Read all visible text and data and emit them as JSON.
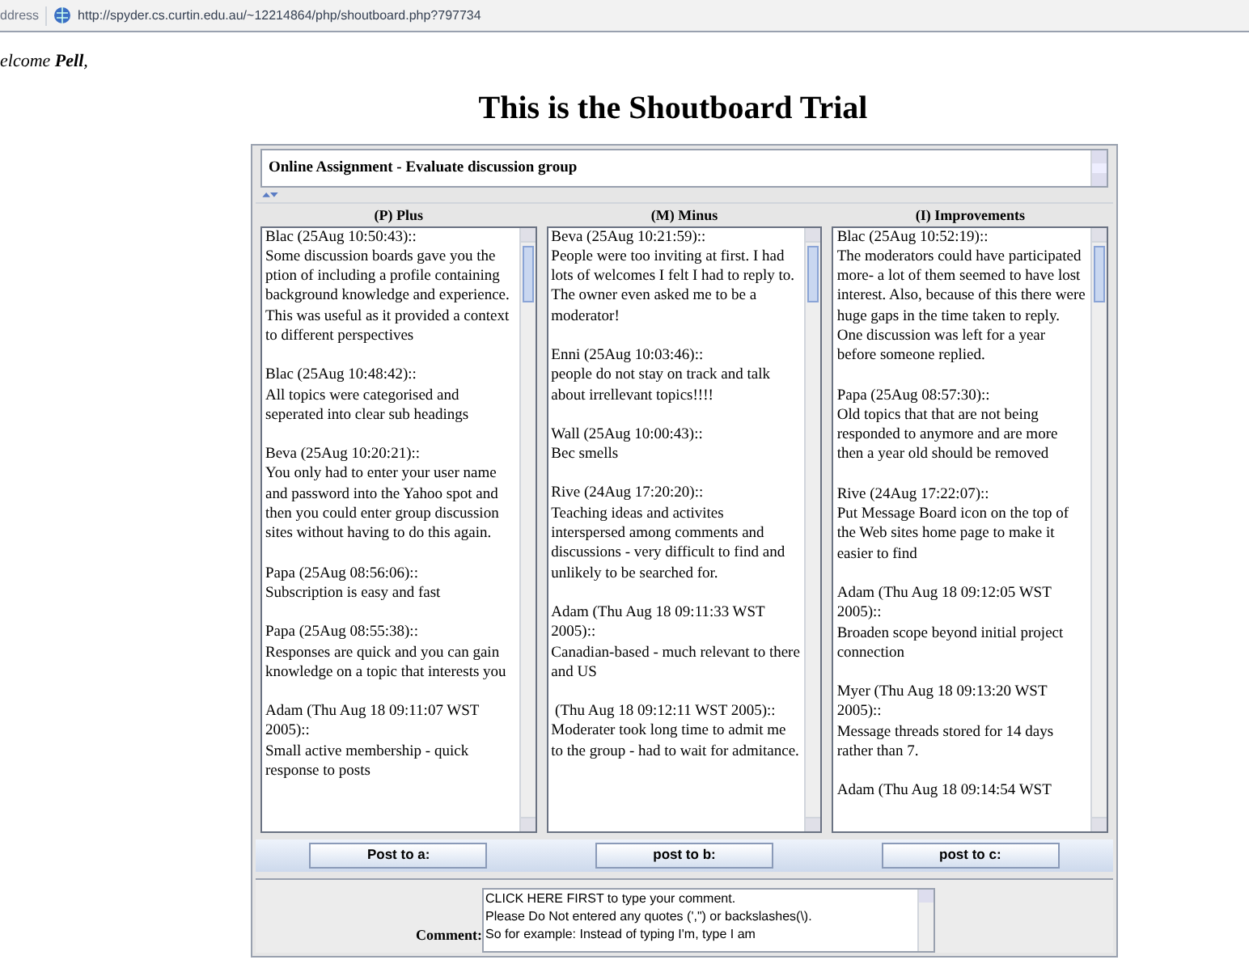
{
  "address_bar": {
    "label": "ddress",
    "url": "http://spyder.cs.curtin.edu.au/~12214864/php/shoutboard.php?797734"
  },
  "welcome": "elcome **Pell**,",
  "title": "This is the Shoutboard Trial",
  "topic": "Online Assignment - Evaluate discussion group",
  "columns": [
    {
      "heading": "(P) Plus",
      "button": "Post to a:",
      "entries": [
        {
          "header": "Blac (25Aug 10:50:43)::",
          "body": "Some discussion boards gave you the ption of including a profile containing background knowledge and experience. This was useful as it provided a context to different perspectives"
        },
        {
          "header": "Blac (25Aug 10:48:42)::",
          "body": "All topics were categorised and seperated into clear sub headings"
        },
        {
          "header": "Beva (25Aug 10:20:21)::",
          "body": "You only had to enter your user name and password into the Yahoo spot and then you could enter group discussion sites without having to do this again."
        },
        {
          "header": "Papa (25Aug 08:56:06)::",
          "body": "Subscription is easy and fast"
        },
        {
          "header": "Papa (25Aug 08:55:38)::",
          "body": "Responses are quick and you can gain knowledge on a topic that interests you"
        },
        {
          "header": "Adam (Thu Aug 18 09:11:07 WST 2005)::",
          "body": "Small active membership - quick response to posts"
        }
      ]
    },
    {
      "heading": "(M) Minus",
      "button": "post to b:",
      "entries": [
        {
          "header": "Beva (25Aug 10:21:59)::",
          "body": "People were too inviting at first. I had lots of welcomes I felt I had to reply to. The owner even asked me to be a moderator!"
        },
        {
          "header": "Enni (25Aug 10:03:46)::",
          "body": "people do not stay on track and talk about irrellevant topics!!!!"
        },
        {
          "header": "Wall (25Aug 10:00:43)::",
          "body": "Bec smells"
        },
        {
          "header": "Rive (24Aug 17:20:20)::",
          "body": "Teaching ideas and activites interspersed among comments and discussions - very difficult to find and unlikely to be searched for."
        },
        {
          "header": "Adam (Thu Aug 18 09:11:33 WST 2005)::",
          "body": "Canadian-based - much relevant to there and US"
        },
        {
          "header": " (Thu Aug 18 09:12:11 WST 2005)::",
          "body": "Moderater took long time to admit me to the group - had to wait for admitance."
        }
      ]
    },
    {
      "heading": "(I) Improvements",
      "button": "post to c:",
      "entries": [
        {
          "header": "Blac (25Aug 10:52:19)::",
          "body": "The moderators could have participated more- a lot of them seemed to have lost interest. Also, because of this there were huge gaps in the time taken to reply. One discussion was left for a year before someone replied."
        },
        {
          "header": "Papa (25Aug 08:57:30)::",
          "body": "Old topics that that are not being responded to anymore and are more then a year old should be removed"
        },
        {
          "header": "Rive (24Aug 17:22:07)::",
          "body": "Put Message Board icon on the top of the Web sites home page to make it easier to find"
        },
        {
          "header": "Adam (Thu Aug 18 09:12:05 WST 2005)::",
          "body": "Broaden scope beyond initial project connection"
        },
        {
          "header": "Myer (Thu Aug 18 09:13:20 WST 2005)::",
          "body": "Message threads stored for 14 days rather than 7."
        },
        {
          "header": "Adam (Thu Aug 18 09:14:54 WST"
        }
      ]
    }
  ],
  "comment": {
    "label": "Comment:",
    "lines": [
      "CLICK HERE FIRST to type your comment.",
      "Please Do Not entered any quotes (',\") or backslashes(\\).",
      "So for example: Instead of typing I'm, type I am"
    ]
  }
}
